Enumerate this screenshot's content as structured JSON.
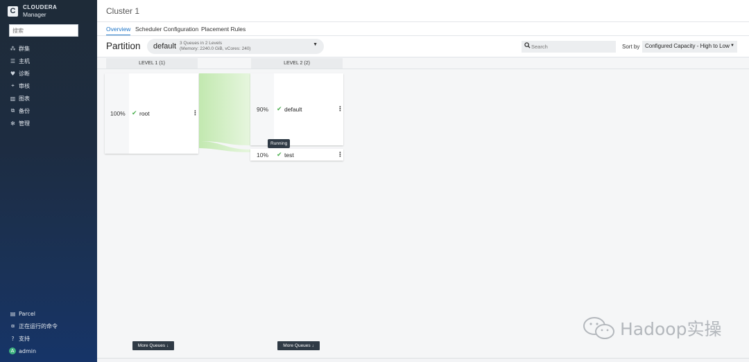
{
  "sidebar": {
    "brand_top": "CLOUDERA",
    "brand_bottom": "Manager",
    "search_placeholder": "搜索",
    "items": [
      {
        "label": "群集",
        "icon": "cluster-icon"
      },
      {
        "label": "主机",
        "icon": "hosts-icon"
      },
      {
        "label": "诊断",
        "icon": "diagnostics-icon"
      },
      {
        "label": "审核",
        "icon": "audit-icon"
      },
      {
        "label": "图表",
        "icon": "charts-icon"
      },
      {
        "label": "备份",
        "icon": "backup-icon"
      },
      {
        "label": "管理",
        "icon": "gear-icon"
      }
    ],
    "bottom_items": [
      {
        "label": "Parcel",
        "icon": "parcel-icon"
      },
      {
        "label": "正在运行的命令",
        "icon": "commands-icon"
      },
      {
        "label": "支持",
        "icon": "help-icon"
      },
      {
        "label": "admin",
        "icon": "avatar-icon",
        "avatar": "A"
      }
    ]
  },
  "header": {
    "title": "Cluster 1"
  },
  "tabs": [
    {
      "label": "Overview",
      "active": true
    },
    {
      "label": "Scheduler Configuration",
      "active": false
    },
    {
      "label": "Placement Rules",
      "active": false
    }
  ],
  "toolbar": {
    "partition_label": "Partition",
    "partition_name": "default",
    "partition_info_1": "3 Queues in 2 Levels",
    "partition_info_2": "(Memory: 2240.0 GiB, vCores: 240)",
    "search_placeholder": "Search",
    "sort_label": "Sort by",
    "sort_value": "Configured Capacity - High to Low"
  },
  "levels": [
    {
      "label": "LEVEL 1 (1)"
    },
    {
      "label": "LEVEL 2 (2)"
    }
  ],
  "queues": {
    "root": {
      "percent": "100%",
      "name": "root",
      "state": "Running"
    },
    "default": {
      "percent": "90%",
      "name": "default",
      "state": "Running"
    },
    "test": {
      "percent": "10%",
      "name": "test",
      "state": "Running"
    }
  },
  "tooltip": "Running",
  "more_queues_label": "More Queues ↓",
  "watermark": "Hadoop实操",
  "colors": {
    "accent": "#1b73c7",
    "check": "#4caf50",
    "flow": "#c8ecb8",
    "sidebar": "#1e2b38"
  }
}
